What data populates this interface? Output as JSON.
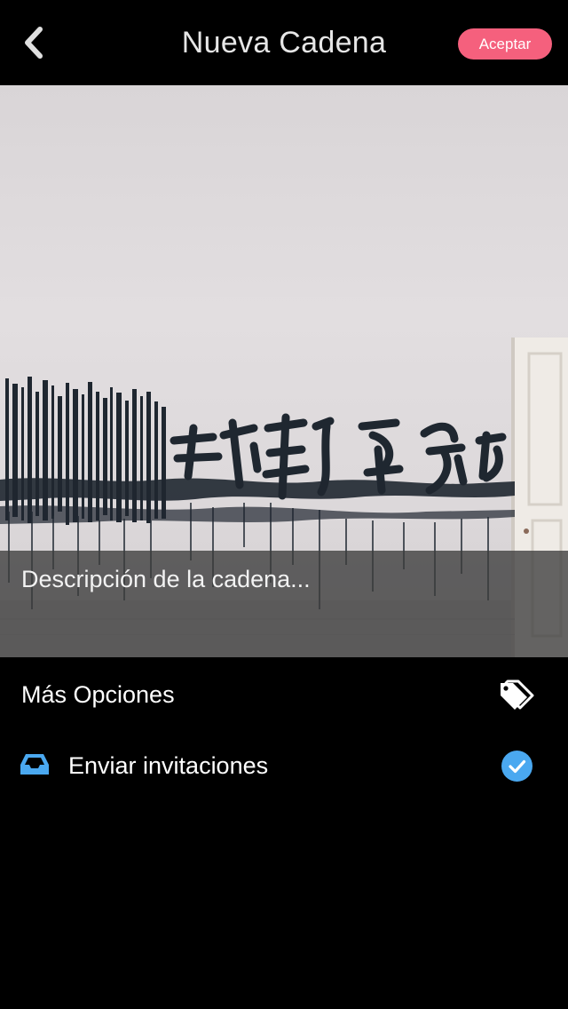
{
  "header": {
    "back_icon": "chevron-left-icon",
    "title": "Nueva Cadena",
    "accept_label": "Aceptar",
    "accept_color": "#f5607d"
  },
  "cover": {
    "description_placeholder": "Descripción de la cadena..."
  },
  "options": {
    "more": {
      "label": "Más Opciones",
      "icon": "tags-icon"
    },
    "invite": {
      "label": "Enviar invitaciones",
      "leading_icon": "inbox-icon",
      "trailing_icon": "check-circle-icon",
      "accent_color": "#4aa8f0",
      "checked": true
    }
  }
}
